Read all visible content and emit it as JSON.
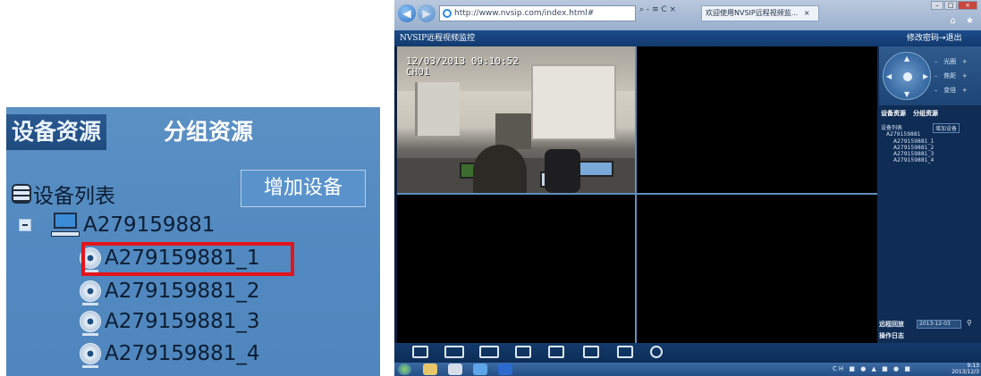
{
  "zoom_panel": {
    "tab_device": "设备资源",
    "tab_group": "分组资源",
    "list_title": "设备列表",
    "add_button": "增加设备",
    "device": "A279159881",
    "channels": [
      "A279159881_1",
      "A279159881_2",
      "A279159881_3",
      "A279159881_4"
    ]
  },
  "browser": {
    "url": "http://www.nvsip.com/index.html#",
    "address_tools": "⌕ - ≡ C ×",
    "tab_title": "欢迎使用NVSIP远程视频监...",
    "tab_close": "×",
    "window_buttons": [
      "–",
      "□",
      "×"
    ],
    "fav_icons": "⌂ ★"
  },
  "app": {
    "title": "NVSIP远程视频监控",
    "change_password": "修改密码",
    "logout": "退出"
  },
  "video": {
    "timestamp": "12/03/2013 09:10:52",
    "channel": "CH01"
  },
  "control": {
    "ptz_rows": [
      {
        "minus": "–",
        "label": "光圈",
        "plus": "+"
      },
      {
        "minus": "–",
        "label": "焦距",
        "plus": "+"
      },
      {
        "minus": "–",
        "label": "变倍",
        "plus": "+"
      }
    ],
    "tab_device": "设备资源",
    "tab_group": "分组资源",
    "list_title": "设备列表",
    "add_button": "增加设备",
    "device": "A279159881",
    "channels": [
      "A279159881_1",
      "A279159881_2",
      "A279159881_3",
      "A279159881_4"
    ],
    "remote_playback": "远程回放",
    "date": "2013-12-03",
    "operation_log": "操作日志"
  },
  "taskbar": {
    "tray": "CH ■ ● ▲ ■ ● ■",
    "time": "9:13",
    "date": "2013/12/3"
  },
  "colors": {
    "highlight": "#e3141b",
    "panel_blue": "#5189c0",
    "header_blue": "#1b4c8a"
  }
}
